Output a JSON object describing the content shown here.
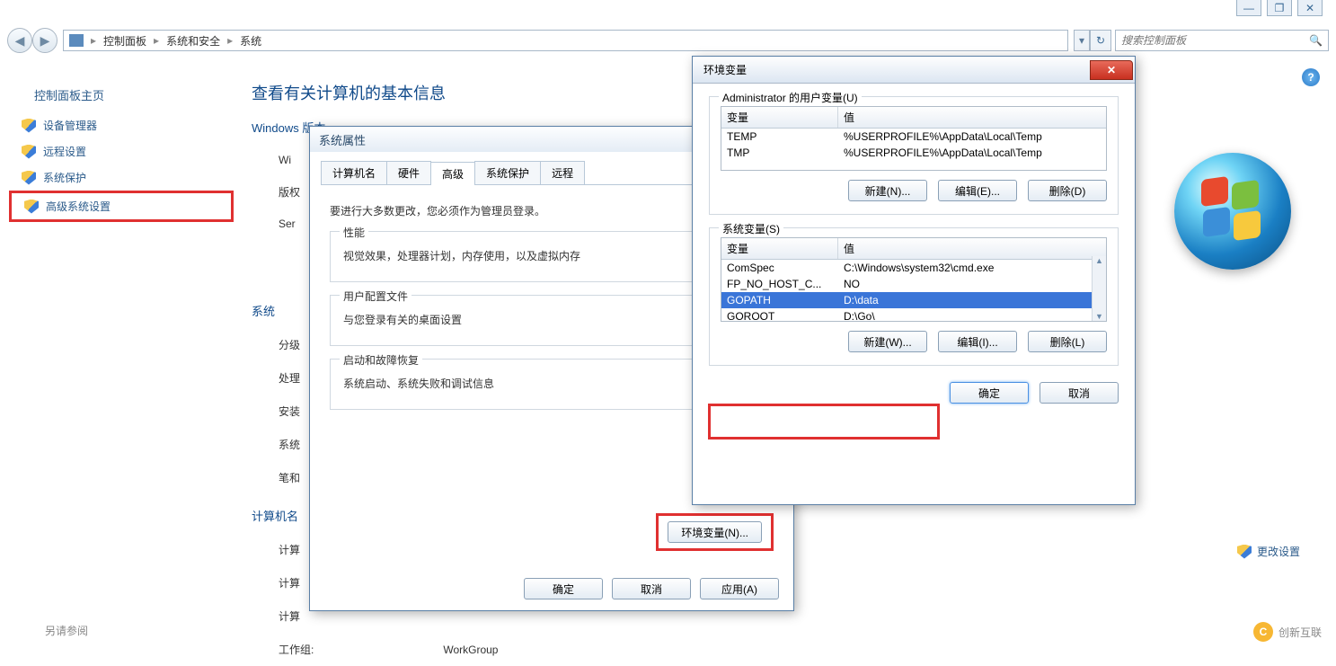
{
  "window_controls": {
    "min": "—",
    "max": "❐",
    "close": "✕"
  },
  "breadcrumb": {
    "items": [
      "控制面板",
      "系统和安全",
      "系统"
    ]
  },
  "search": {
    "placeholder": "搜索控制面板"
  },
  "sidebar": {
    "home": "控制面板主页",
    "links": [
      {
        "label": "设备管理器"
      },
      {
        "label": "远程设置"
      },
      {
        "label": "系统保护"
      },
      {
        "label": "高级系统设置",
        "hl": true
      }
    ],
    "also": "另请参阅"
  },
  "main": {
    "title": "查看有关计算机的基本信息",
    "windows_edition": "Windows 版本",
    "rows": {
      "wi": "Wi",
      "copyright": "版权",
      "ser": "Ser"
    },
    "system_section": "系统",
    "system_rows": [
      "分级",
      "处理",
      "安装",
      "系统",
      "笔和"
    ],
    "computer_section": "计算机名",
    "computer_rows": [
      "计算",
      "计算",
      "计算"
    ],
    "workgroup_label": "工作组:",
    "workgroup_value": "WorkGroup",
    "change_settings": "更改设置"
  },
  "dlg_sys": {
    "title": "系统属性",
    "tabs": [
      "计算机名",
      "硬件",
      "高级",
      "系统保护",
      "远程"
    ],
    "active_tab": 2,
    "admin_note": "要进行大多数更改，您必须作为管理员登录。",
    "perf": {
      "legend": "性能",
      "desc": "视觉效果，处理器计划，内存使用，以及虚拟内存"
    },
    "profile": {
      "legend": "用户配置文件",
      "desc": "与您登录有关的桌面设置"
    },
    "startup": {
      "legend": "启动和故障恢复",
      "desc": "系统启动、系统失败和调试信息"
    },
    "env_btn": "环境变量(N)...",
    "ok": "确定",
    "cancel": "取消",
    "apply": "应用(A)"
  },
  "dlg_env": {
    "title": "环境变量",
    "user_legend": "Administrator 的用户变量(U)",
    "hdr_var": "变量",
    "hdr_val": "值",
    "user_vars": [
      {
        "name": "TEMP",
        "value": "%USERPROFILE%\\AppData\\Local\\Temp"
      },
      {
        "name": "TMP",
        "value": "%USERPROFILE%\\AppData\\Local\\Temp"
      }
    ],
    "user_btns": {
      "new": "新建(N)...",
      "edit": "编辑(E)...",
      "del": "删除(D)"
    },
    "sys_legend": "系统变量(S)",
    "sys_vars": [
      {
        "name": "ComSpec",
        "value": "C:\\Windows\\system32\\cmd.exe"
      },
      {
        "name": "FP_NO_HOST_C...",
        "value": "NO"
      },
      {
        "name": "GOPATH",
        "value": "D:\\data",
        "sel": true
      },
      {
        "name": "GOROOT",
        "value": "D:\\Go\\"
      }
    ],
    "sys_btns": {
      "new": "新建(W)...",
      "edit": "编辑(I)...",
      "del": "删除(L)"
    },
    "ok": "确定",
    "cancel": "取消"
  },
  "brand": "创新互联"
}
